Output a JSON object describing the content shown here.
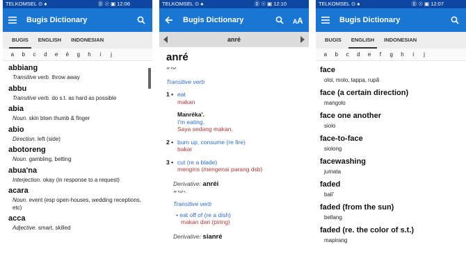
{
  "status": {
    "carrier": "TELKOMSEL",
    "left_icons": "⊙ ♠",
    "right_icons": "Ⓑ ☉ ▣",
    "screen1_time": "12:06",
    "screen2_time": "12:10",
    "screen3_time": "12:07"
  },
  "app": {
    "title": "Bugis Dictionary"
  },
  "tabs": [
    "BUGIS",
    "ENGLISH",
    "INDONESIAN"
  ],
  "letters": [
    "a",
    "b",
    "c",
    "d",
    "e",
    "é",
    "g",
    "h",
    "i",
    "j"
  ],
  "screen1": {
    "entries": [
      {
        "word": "abbiang",
        "pos": "Transitive verb.",
        "def": "throw away"
      },
      {
        "word": "abbu",
        "pos": "Transitive verb.",
        "def": "do s.t. as hard as possible"
      },
      {
        "word": "abia",
        "pos": "Noun.",
        "def": "skin btwn thumb & finger"
      },
      {
        "word": "abio",
        "pos": "Direction.",
        "def": "left (side)"
      },
      {
        "word": "abotoreng",
        "pos": "Noun.",
        "def": "gambling, betting"
      },
      {
        "word": "abua'na",
        "pos": "Interjection.",
        "def": "okay (in response to a request)"
      },
      {
        "word": "acara",
        "pos": "Noun.",
        "def": "event (esp open-houses, wedding receptions, etc)"
      },
      {
        "word": "acca",
        "pos": "Adjective.",
        "def": "smart, skilled"
      }
    ]
  },
  "screen2": {
    "nav_word": "anré",
    "headword": "anré",
    "script": "ᨀᨉᨙ",
    "pos": "Transitive verb",
    "sense1_num": "1",
    "sense1_en": "eat",
    "sense1_id": "makan",
    "example_title": "Manréka'.",
    "example_en": "I'm eating.",
    "example_id": "Saya sedang makan.",
    "sense2_num": "2",
    "sense2_en": "burn up, consume (re fire)",
    "sense2_id": "bakar",
    "sense3_num": "3",
    "sense3_en": "cut (re a blade)",
    "sense3_id": "mengiris (mengenai parang dsb)",
    "deriv_label": "Derivative:",
    "deriv1_word": "anréi",
    "deriv1_script": "ᨀᨉᨙᨚ",
    "deriv1_pos": "Transitive verb",
    "deriv1_en": "eat off of (re a dish)",
    "deriv1_id": "makan dari (piring)",
    "deriv2_word": "sianré"
  },
  "screen3": {
    "entries": [
      {
        "word": "face",
        "trans": "oloi, molo, tappa, rupã"
      },
      {
        "word": "face (a certain direction)",
        "trans": "mangolo"
      },
      {
        "word": "face one another",
        "trans": "siolo"
      },
      {
        "word": "face-to-face",
        "trans": "siolong"
      },
      {
        "word": "facewashing",
        "trans": "jumata"
      },
      {
        "word": "faded",
        "trans": "bali'"
      },
      {
        "word": "faded (from the sun)",
        "trans": "bellang"
      },
      {
        "word": "faded (re. the color of s.t.)",
        "trans": "mapirang"
      }
    ]
  },
  "colors": {
    "statusbar": "#0d47a1",
    "appbar": "#1976d2",
    "link_blue": "#2e6bd1",
    "indonesian_red": "#b23a3a"
  },
  "icons": [
    "menu-icon",
    "search-icon",
    "back-arrow-icon",
    "text-size-icon"
  ]
}
